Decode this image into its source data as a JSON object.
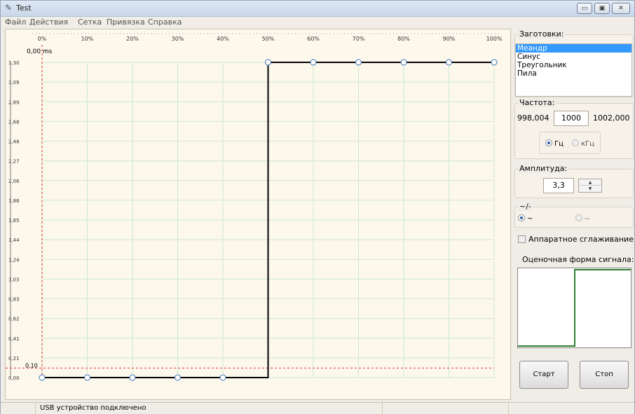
{
  "window": {
    "title": "Test",
    "buttons": {
      "minimize": "▭",
      "maximize": "▣",
      "close": "✕"
    }
  },
  "menu": [
    "Файл",
    "Действия",
    "Сетка",
    "Привязка",
    "Справка"
  ],
  "plot": {
    "time_label": "0,00 ms",
    "marker_label": "0,10",
    "x_ticks": [
      "0%",
      "10%",
      "20%",
      "30%",
      "40%",
      "50%",
      "60%",
      "70%",
      "80%",
      "90%",
      "100%"
    ],
    "y_ticks": [
      "3,30",
      "3,09",
      "2,89",
      "2,68",
      "2,48",
      "2,27",
      "2,06",
      "1,86",
      "1,65",
      "1,44",
      "1,24",
      "1,03",
      "0,83",
      "0,62",
      "0,41",
      "0,21",
      "0,00"
    ]
  },
  "chart_data": {
    "type": "line",
    "x": [
      0,
      10,
      20,
      30,
      40,
      50,
      50,
      60,
      70,
      80,
      90,
      100
    ],
    "y": [
      0,
      0,
      0,
      0,
      0,
      0,
      3.3,
      3.3,
      3.3,
      3.3,
      3.3,
      3.3
    ],
    "ylim": [
      0,
      3.3
    ],
    "xlim": [
      0,
      100
    ],
    "marker_points_x": [
      0,
      10,
      20,
      30,
      40,
      50,
      60,
      70,
      80,
      90,
      100
    ],
    "threshold_y": 0.1
  },
  "presets": {
    "legend": "Заготовки:",
    "items": [
      "Меандр",
      "Синус",
      "Треугольник",
      "Пила"
    ],
    "selected": "Меандр"
  },
  "frequency": {
    "legend": "Частота:",
    "min": "998,004",
    "value": "1000",
    "max": "1002,000",
    "units": [
      "Гц",
      "кГц"
    ],
    "selected_unit": "Гц"
  },
  "amplitude": {
    "legend": "Амплитуда:",
    "value": "3,3"
  },
  "coupling": {
    "legend": "~/-",
    "options": [
      "~",
      "--"
    ],
    "selected": "~"
  },
  "smoothing": {
    "label": "Аппаратное сглаживание",
    "checked": false
  },
  "estimate": {
    "label": "Оценочная форма сигнала:"
  },
  "actions": {
    "start": "Старт",
    "stop": "Стоп"
  },
  "status": {
    "text": "USB устройство подключено"
  },
  "colors": {
    "grid": "#cfe8cf",
    "trace": "#000000",
    "marker": "#e03030",
    "point_stroke": "#3b6fb6",
    "estimate_wave": "#2e7d2e"
  }
}
